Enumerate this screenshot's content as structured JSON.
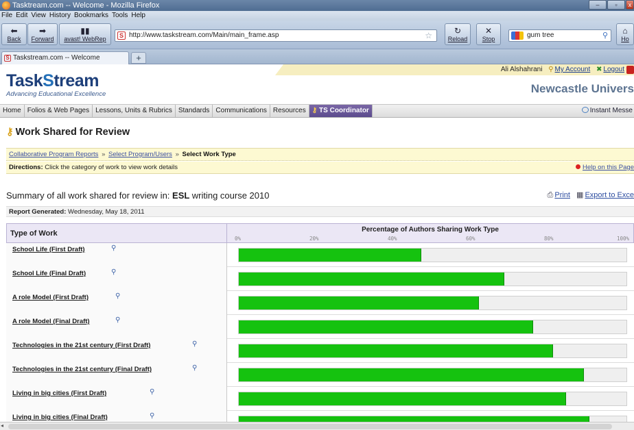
{
  "window": {
    "title": "Tasktream.com -- Welcome - Mozilla Firefox",
    "min": "–",
    "max": "▫",
    "close": "x"
  },
  "menu": [
    "File",
    "Edit",
    "View",
    "History",
    "Bookmarks",
    "Tools",
    "Help"
  ],
  "nav": {
    "back_label": "Back",
    "forward_label": "Forward",
    "avast_label": "avast! WebRep",
    "url": "http://www.taskstream.com/Main/main_frame.asp",
    "reload_label": "Reload",
    "stop_label": "Stop",
    "search_value": "gum tree",
    "home_label": "Ho"
  },
  "tabs": [
    {
      "label": "Taskstream.com -- Welcome"
    }
  ],
  "newtab_label": "+",
  "site": {
    "user_name": "Ali Alshahrani",
    "my_account": "My Account",
    "logout": "Logout",
    "logo_a": "Task",
    "logo_s": "S",
    "logo_b": "tream",
    "tagline": "Advancing Educational Excellence",
    "institution": "Newcastle Univers"
  },
  "mainnav": [
    "Home",
    "Folios & Web Pages",
    "Lessons, Units & Rubrics",
    "Standards",
    "Communications",
    "Resources"
  ],
  "mainnav_active": "TS Coordinator",
  "instant_messenger": "Instant Messe",
  "page": {
    "title": "Work Shared for Review",
    "crumbs": [
      "Collaborative Program Reports",
      "Select Program/Users"
    ],
    "crumb_sep": "»",
    "crumb_current": "Select Work Type",
    "directions_label": "Directions:",
    "directions_text": "Click the category of work to view work details",
    "help_link": "Help on this Page",
    "summary_prefix": "Summary of all work shared for review in:",
    "summary_program": "ESL",
    "summary_course": "writing course 2010",
    "print_label": "Print",
    "export_label": "Export to Exce",
    "generated_label": "Report Generated:",
    "generated_value": "Wednesday, May 18, 2011"
  },
  "table": {
    "col_type": "Type of Work",
    "col_pct": "Percentage of Authors Sharing Work Type",
    "ticks": [
      "0%",
      "20%",
      "40%",
      "60%",
      "80%",
      "100%"
    ],
    "rows": [
      {
        "label": "School Life (First Draft)",
        "value": 0.47
      },
      {
        "label": "School Life (Final Draft)",
        "value": 0.685
      },
      {
        "label": "A role Model (First Draft)",
        "value": 0.62
      },
      {
        "label": "A role Model (Final Draft)",
        "value": 0.76
      },
      {
        "label": "Technologies in the 21st century (First Draft)",
        "value": 0.81
      },
      {
        "label": "Technologies in the 21st century (Final Draft)",
        "value": 0.89
      },
      {
        "label": "Living in big cities  (First Draft)",
        "value": 0.845
      },
      {
        "label": "Living in big cities  (Final Draft)",
        "value": 0.905
      }
    ]
  },
  "colors": {
    "bar_fill": "#15c20f",
    "accent_nav": "#5b4b8d",
    "banner": "#fdf9d2"
  }
}
